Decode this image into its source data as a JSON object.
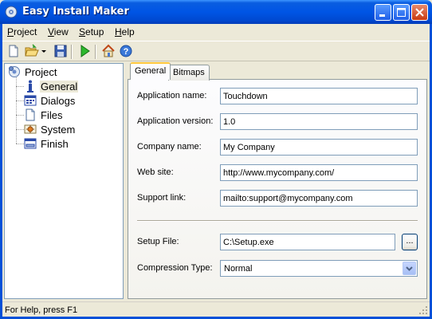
{
  "window": {
    "title": "Easy Install Maker"
  },
  "menu": [
    {
      "first": "P",
      "rest": "roject"
    },
    {
      "first": "V",
      "rest": "iew"
    },
    {
      "first": "S",
      "rest": "etup"
    },
    {
      "first": "H",
      "rest": "elp"
    }
  ],
  "toolbar": {
    "icons": [
      "new-file-icon",
      "open-folder-icon",
      "dropdown-arrow-icon",
      "save-icon",
      "run-icon",
      "home-icon",
      "help-icon"
    ]
  },
  "tree": {
    "root": "Project",
    "items": [
      "General",
      "Dialogs",
      "Files",
      "System",
      "Finish"
    ],
    "selected": "General"
  },
  "tabs": {
    "general": "General",
    "bitmaps": "Bitmaps"
  },
  "form": {
    "app_name": {
      "label": "Application name:",
      "value": "Touchdown"
    },
    "app_version": {
      "label": "Application version:",
      "value": "1.0"
    },
    "company": {
      "label": "Company name:",
      "value": "My Company"
    },
    "website": {
      "label": "Web site:",
      "value": "http://www.mycompany.com/"
    },
    "support": {
      "label": "Support link:",
      "value": "mailto:support@mycompany.com"
    },
    "setup_file": {
      "label": "Setup File:",
      "value": "C:\\Setup.exe",
      "browse": "..."
    },
    "compression": {
      "label": "Compression Type:",
      "value": "Normal"
    }
  },
  "status": {
    "text": "For Help, press F1"
  },
  "colors": {
    "titlebar": "#0055e5",
    "accent_tab": "#ffc83c",
    "input_border": "#7f9db9"
  }
}
